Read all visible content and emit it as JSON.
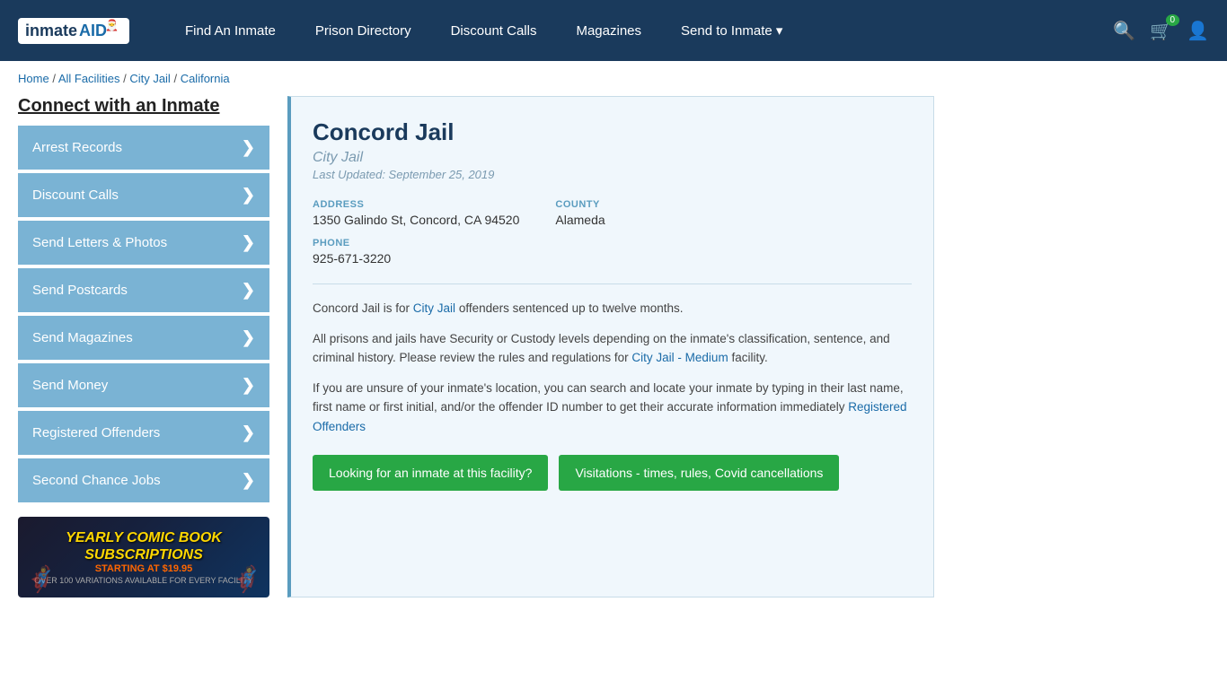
{
  "nav": {
    "logo_text": "inmateAID",
    "links": [
      {
        "label": "Find An Inmate",
        "name": "find-inmate-link"
      },
      {
        "label": "Prison Directory",
        "name": "prison-directory-link"
      },
      {
        "label": "Discount Calls",
        "name": "discount-calls-link"
      },
      {
        "label": "Magazines",
        "name": "magazines-link"
      },
      {
        "label": "Send to Inmate ▾",
        "name": "send-to-inmate-link"
      }
    ],
    "cart_count": "0"
  },
  "breadcrumb": {
    "home": "Home",
    "all_facilities": "All Facilities",
    "city_jail": "City Jail",
    "state": "California"
  },
  "sidebar": {
    "title": "Connect with an Inmate",
    "items": [
      {
        "label": "Arrest Records",
        "name": "arrest-records-item"
      },
      {
        "label": "Discount Calls",
        "name": "discount-calls-item"
      },
      {
        "label": "Send Letters & Photos",
        "name": "send-letters-item"
      },
      {
        "label": "Send Postcards",
        "name": "send-postcards-item"
      },
      {
        "label": "Send Magazines",
        "name": "send-magazines-item"
      },
      {
        "label": "Send Money",
        "name": "send-money-item"
      },
      {
        "label": "Registered Offenders",
        "name": "registered-offenders-item"
      },
      {
        "label": "Second Chance Jobs",
        "name": "second-chance-jobs-item"
      }
    ],
    "ad": {
      "title": "YEARLY COMIC BOOK\nSUBSCRIPTIONS",
      "price": "STARTING AT $19.95",
      "bottom": "OVER 100 VARIATIONS AVAILABLE FOR EVERY FACILITY"
    }
  },
  "facility": {
    "name": "Concord Jail",
    "type": "City Jail",
    "last_updated": "Last Updated: September 25, 2019",
    "address_label": "ADDRESS",
    "address_value": "1350 Galindo St, Concord, CA 94520",
    "county_label": "COUNTY",
    "county_value": "Alameda",
    "phone_label": "PHONE",
    "phone_value": "925-671-3220",
    "desc1": "Concord Jail is for City Jail offenders sentenced up to twelve months.",
    "desc2": "All prisons and jails have Security or Custody levels depending on the inmate's classification, sentence, and criminal history. Please review the rules and regulations for City Jail - Medium facility.",
    "desc3": "If you are unsure of your inmate's location, you can search and locate your inmate by typing in their last name, first name or first initial, and/or the offender ID number to get their accurate information immediately Registered Offenders",
    "city_jail_link": "City Jail",
    "city_jail_medium_link": "City Jail - Medium",
    "registered_offenders_link": "Registered Offenders",
    "btn_inmate": "Looking for an inmate at this facility?",
    "btn_visitation": "Visitations - times, rules, Covid cancellations"
  }
}
